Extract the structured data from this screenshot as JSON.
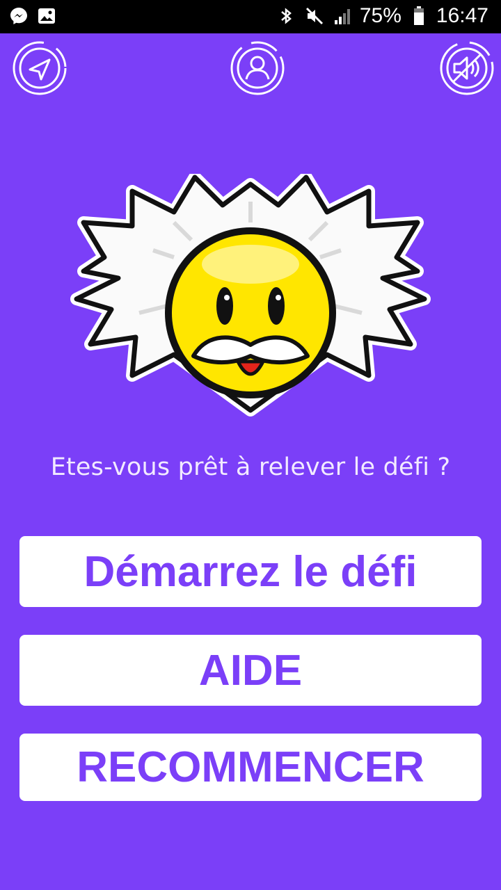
{
  "status_bar": {
    "battery": "75%",
    "time": "16:47",
    "left_icons": [
      "messenger-icon",
      "image-icon"
    ],
    "right_icons": [
      "bluetooth-icon",
      "mute-icon",
      "signal-icon",
      "battery-icon"
    ]
  },
  "toolbar": {
    "left_icon": "navigation-arrow-icon",
    "center_icon": "profile-icon",
    "right_icon": "sound-off-icon"
  },
  "main": {
    "prompt": "Etes-vous prêt à relever le défi ?",
    "buttons": {
      "start": "Démarrez le défi",
      "help": "AIDE",
      "restart": "RECOMMENCER"
    }
  },
  "colors": {
    "background": "#7b3ff8",
    "button_bg": "#ffffff",
    "button_text": "#7b3ff8"
  }
}
